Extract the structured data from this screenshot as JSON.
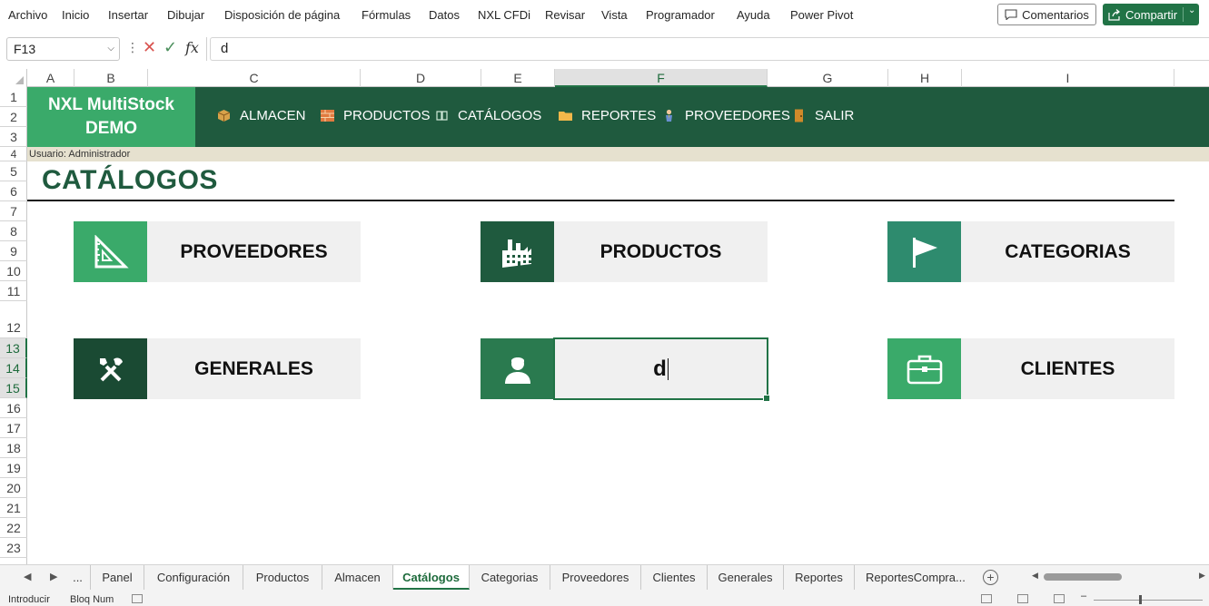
{
  "ribbon": {
    "menus": [
      "Archivo",
      "Inicio",
      "Insertar",
      "Dibujar",
      "Disposición de página",
      "Fórmulas",
      "Datos",
      "NXL CFDi",
      "Revisar",
      "Vista",
      "Programador",
      "Ayuda",
      "Power Pivot"
    ],
    "comments_label": "Comentarios",
    "share_label": "Compartir"
  },
  "formula_bar": {
    "name_box": "F13",
    "fx": "fx",
    "value": "d"
  },
  "grid": {
    "columns": [
      "A",
      "B",
      "C",
      "D",
      "E",
      "F",
      "G",
      "H",
      "I"
    ],
    "selected_column": "F",
    "rows": [
      "1",
      "2",
      "3",
      "4",
      "5",
      "6",
      "7",
      "8",
      "9",
      "10",
      "11",
      "12",
      "13",
      "14",
      "15",
      "16",
      "17",
      "18",
      "19",
      "20",
      "21",
      "22",
      "23"
    ],
    "selected_rows": [
      "13",
      "14",
      "15"
    ]
  },
  "app": {
    "logo_line1": "NXL MultiStock",
    "logo_line2": "DEMO",
    "nav": [
      {
        "label": "ALMACEN",
        "icon": "box-icon"
      },
      {
        "label": "PRODUCTOS",
        "icon": "bricks-icon"
      },
      {
        "label": "CATÁLOGOS",
        "icon": "catalog-icon"
      },
      {
        "label": "REPORTES",
        "icon": "folder-icon"
      },
      {
        "label": "PROVEEDORES",
        "icon": "person-icon"
      },
      {
        "label": "SALIR",
        "icon": "door-icon"
      }
    ],
    "user": "Usuario: Administrador",
    "page_title": "CATÁLOGOS",
    "cards": [
      {
        "label": "PROVEEDORES",
        "icon": "set-square-icon",
        "color": "#3aaa6a"
      },
      {
        "label": "PRODUCTOS",
        "icon": "factory-icon",
        "color": "#1f5a3e"
      },
      {
        "label": "CATEGORIAS",
        "icon": "flag-icon",
        "color": "#2e8b6e"
      },
      {
        "label": "GENERALES",
        "icon": "tools-icon",
        "color": "#1a4a33"
      },
      {
        "label": "d",
        "icon": "user-icon",
        "color": "#2a7a4f"
      },
      {
        "label": "CLIENTES",
        "icon": "briefcase-icon",
        "color": "#3aaa6a"
      }
    ]
  },
  "sheet_tabs": {
    "more": "...",
    "tabs": [
      "Panel",
      "Configuración",
      "Productos",
      "Almacen",
      "Catálogos",
      "Categorias",
      "Proveedores",
      "Clientes",
      "Generales",
      "Reportes",
      "ReportesCompra..."
    ],
    "active": "Catálogos"
  },
  "status_bar": {
    "mode": "Introducir",
    "num_lock": "Bloq Num"
  },
  "colors": {
    "excel_green": "#217346",
    "banner_dark": "#1f5a3e",
    "logo_green": "#3aaa6a",
    "user_bar": "#e6e1cf"
  }
}
